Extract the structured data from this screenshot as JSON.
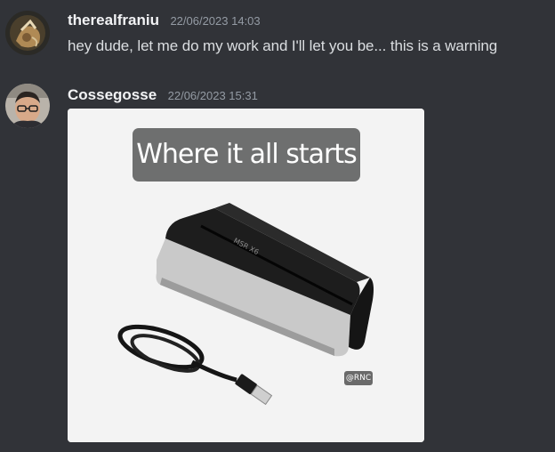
{
  "messages": [
    {
      "username": "therealfraniu",
      "timestamp": "22/06/2023 14:03",
      "text": "hey dude, let me do my work and I'll let you be... this is a warning"
    },
    {
      "username": "Cossegosse",
      "timestamp": "22/06/2023 15:31",
      "attachment": {
        "caption": "Where it all starts",
        "device_label": "MSR X6",
        "watermark": "@RNC"
      }
    }
  ],
  "colors": {
    "background": "#313338",
    "username": "#f2f3f5",
    "timestamp": "#949ba4",
    "message_text": "#dbdee1"
  }
}
